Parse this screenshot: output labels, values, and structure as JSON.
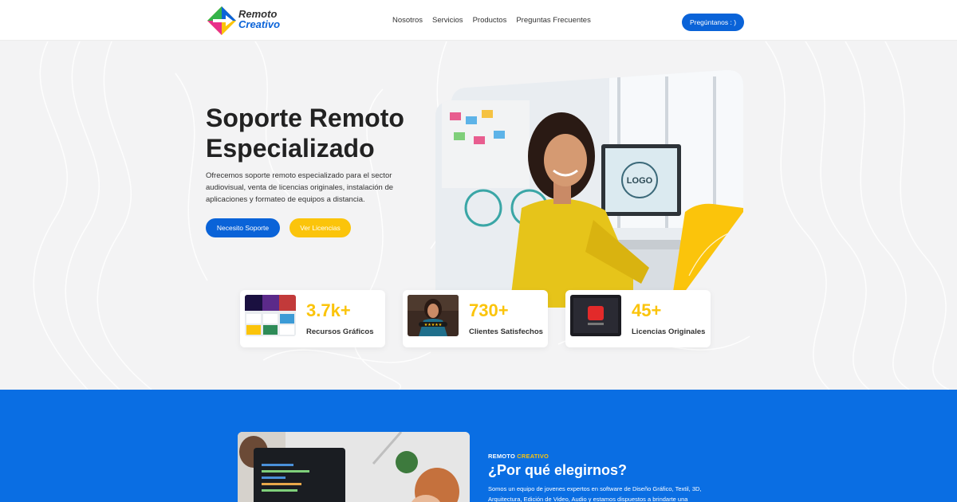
{
  "brand": {
    "line1": "Remoto",
    "line2": "Creativo"
  },
  "nav": {
    "items": [
      "Nosotros",
      "Servicios",
      "Productos",
      "Preguntas Frecuentes"
    ],
    "cta": "Pregúntanos : )"
  },
  "hero": {
    "title_line1": "Soporte Remoto",
    "title_line2": "Especializado",
    "description": "Ofrecemos soporte remoto especializado para el sector audiovisual, venta de licencias originales, instalación de aplicaciones y formateo de equipos a distancia.",
    "btn_primary": "Necesito Soporte",
    "btn_secondary": "Ver Licencias",
    "photo_text": "LOGO"
  },
  "stats": [
    {
      "number": "3.7k+",
      "label": "Recursos Gráficos"
    },
    {
      "number": "730+",
      "label": "Clientes Satisfechos"
    },
    {
      "number": "45+",
      "label": "Licencias Originales"
    }
  ],
  "why": {
    "eyebrow_a": "REMOTO",
    "eyebrow_b": "CREATIVO",
    "title": "¿Por qué elegirnos?",
    "description": "Somos un equipo de jovenes expertos en software de Diseño Gráfico, Textil, 3D, Arquitectura, Edición de Video, Audio y estamos dispuestos a brindarte una"
  },
  "colors": {
    "primary": "#0a63d8",
    "accent": "#fbc40b",
    "section_blue": "#0a6ee3"
  }
}
